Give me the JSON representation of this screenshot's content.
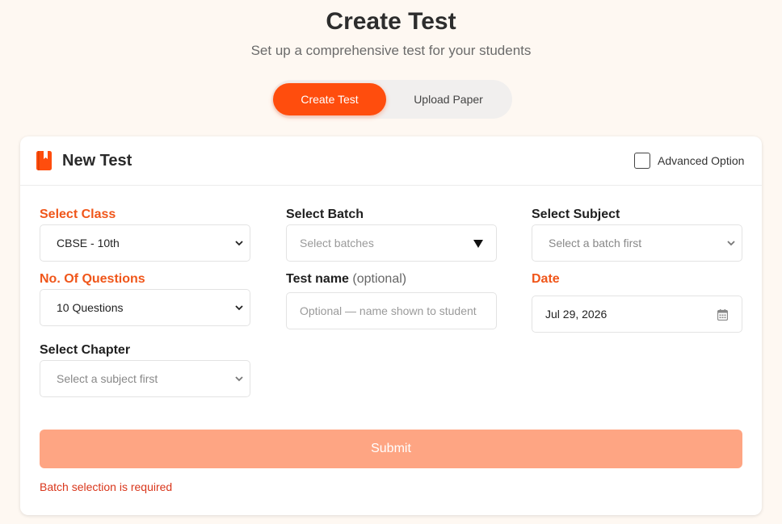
{
  "header": {
    "title": "Create Test",
    "subtitle": "Set up a comprehensive test for your students"
  },
  "mode_toggle": {
    "active_label": "Create Test",
    "inactive_label": "Upload Paper"
  },
  "card": {
    "title": "New Test",
    "advanced_option_label": "Advanced Option",
    "advanced_option_checked": false
  },
  "form": {
    "select_class": {
      "label": "Select Class",
      "value": "CBSE - 10th"
    },
    "select_batch": {
      "label": "Select Batch",
      "placeholder": "Select batches"
    },
    "select_subject": {
      "label": "Select Subject",
      "value": "Select a batch first"
    },
    "num_questions": {
      "label": "No. Of Questions",
      "value": "10 Questions"
    },
    "test_name": {
      "label": "Test name",
      "label_suffix": "(optional)",
      "placeholder": "Optional — name shown to student"
    },
    "date": {
      "label": "Date",
      "value": "Jul 29, 2026"
    },
    "select_chapter": {
      "label": "Select Chapter",
      "value": "Select a subject first"
    }
  },
  "submit": {
    "label": "Submit"
  },
  "error": {
    "message": "Batch selection is required"
  },
  "colors": {
    "accent": "#ff4d0d",
    "required_label": "#f0561a",
    "submit_disabled": "#fea583",
    "error": "#d9361b",
    "background": "#fef8f2"
  },
  "icons": {
    "card_icon": "bookmark-book-icon",
    "dropdown": "chevron-down-icon",
    "batch_dropdown": "triangle-down-icon",
    "date": "calendar-icon"
  }
}
